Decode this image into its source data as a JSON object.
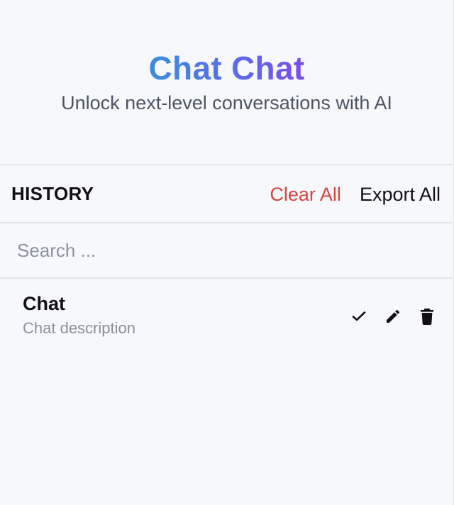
{
  "brand": {
    "title": "Chat Chat",
    "subtitle": "Unlock next-level conversations with AI",
    "gradient_colors": [
      "#3b8be0",
      "#7b4df0"
    ]
  },
  "history": {
    "title": "HISTORY",
    "clear_label": "Clear All",
    "export_label": "Export All",
    "clear_color": "#d64541"
  },
  "search": {
    "placeholder": "Search ...",
    "value": ""
  },
  "chats": [
    {
      "title": "Chat",
      "description": "Chat description",
      "icons": [
        "check-icon",
        "pencil-icon",
        "trash-icon"
      ]
    }
  ]
}
